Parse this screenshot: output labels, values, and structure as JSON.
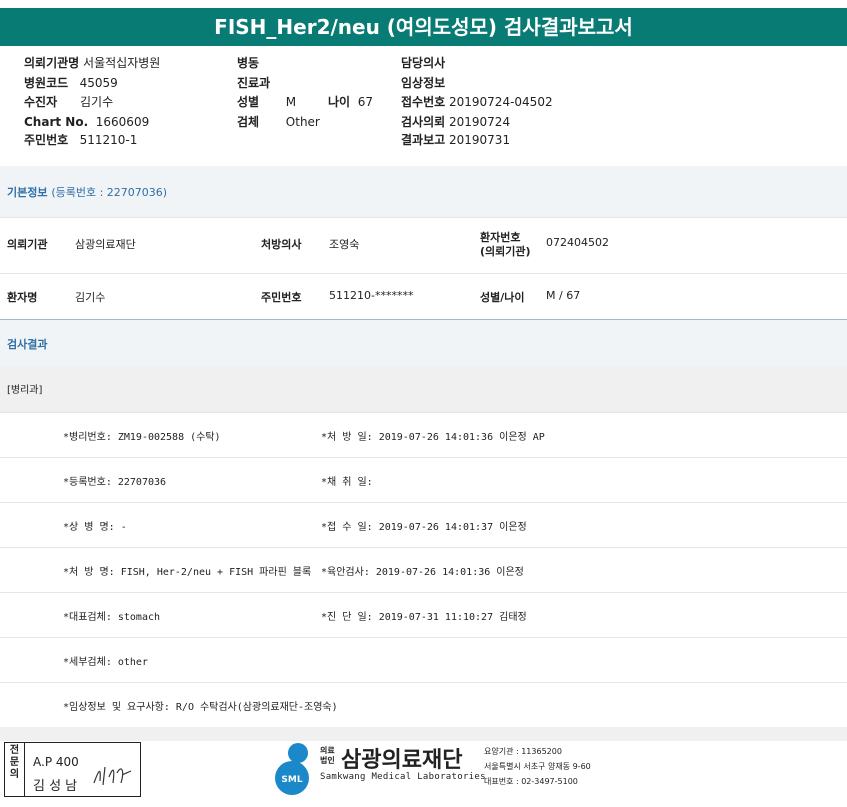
{
  "report": {
    "title": "FISH_Her2/neu (여의도성모) 검사결과보고서"
  },
  "header": {
    "col1": [
      {
        "label": "의뢰기관명",
        "value": "서울적십자병원"
      },
      {
        "label": "병원코드",
        "value": "45059"
      },
      {
        "label": "수진자",
        "value": "김기수"
      },
      {
        "label": "Chart No.",
        "value": "1660609"
      },
      {
        "label": "주민번호",
        "value": "511210-1"
      }
    ],
    "col2": [
      {
        "label": "병동",
        "value": ""
      },
      {
        "label": "진료과",
        "value": ""
      },
      {
        "label": "성별",
        "value": "M"
      },
      {
        "label": "검체",
        "value": "Other"
      }
    ],
    "age_label": "나이",
    "age_value": "67",
    "col3": [
      {
        "label": "담당의사",
        "value": ""
      },
      {
        "label": "임상정보",
        "value": ""
      },
      {
        "label": "접수번호",
        "value": "20190724-04502"
      },
      {
        "label": "검사의뢰",
        "value": "20190724"
      },
      {
        "label": "결과보고",
        "value": "20190731"
      }
    ]
  },
  "basic": {
    "title": "기본정보",
    "subtitle": "(등록번호 : 22707036)",
    "row1": [
      {
        "label": "의뢰기관",
        "value": "삼광의료재단"
      },
      {
        "label": "처방의사",
        "value": "조영숙"
      },
      {
        "label_line1": "환자번호",
        "label_line2": "(의뢰기관)",
        "value": "072404502"
      }
    ],
    "row2": [
      {
        "label": "환자명",
        "value": "김기수"
      },
      {
        "label": "주민번호",
        "value": "511210-*******"
      },
      {
        "label": "성별/나이",
        "value": "M / 67"
      }
    ]
  },
  "results": {
    "title": "검사결과",
    "dept": "[병리과]",
    "left": [
      "*병리번호: ZM19-002588 (수탁)",
      "*등록번호: 22707036",
      "*상 병 명: -",
      "*처 방 명: FISH, Her-2/neu + FISH 파라핀 블록",
      "*대표검체: stomach",
      "*세부검체: other",
      "*임상정보 및 요구사항: R/O 수탁검사(삼광의료재단-조영숙)"
    ],
    "right": [
      "*처 방 일: 2019-07-26 14:01:36  이은정 AP",
      "*채 취 일:",
      "*접 수 일: 2019-07-26 14:01:37  이은정",
      "*육안검사: 2019-07-26 14:01:36  이은정",
      "*진 단 일: 2019-07-31 11:10:27  김태정",
      "",
      ""
    ]
  },
  "footer": {
    "sign_vertical": "전문의",
    "sign_code": "A.P 400",
    "sign_name": "김 성 남",
    "logo_small_1": "의료",
    "logo_small_2": "법인",
    "logo_name": "삼광의료재단",
    "logo_en": "Samkwang Medical Laboratories",
    "logo_mark": "SML",
    "info1": "요양기관 : 11365200",
    "info2": "서울특별시 서초구 양재동 9-60",
    "info3": "대표번호 : 02-3497-5100"
  }
}
